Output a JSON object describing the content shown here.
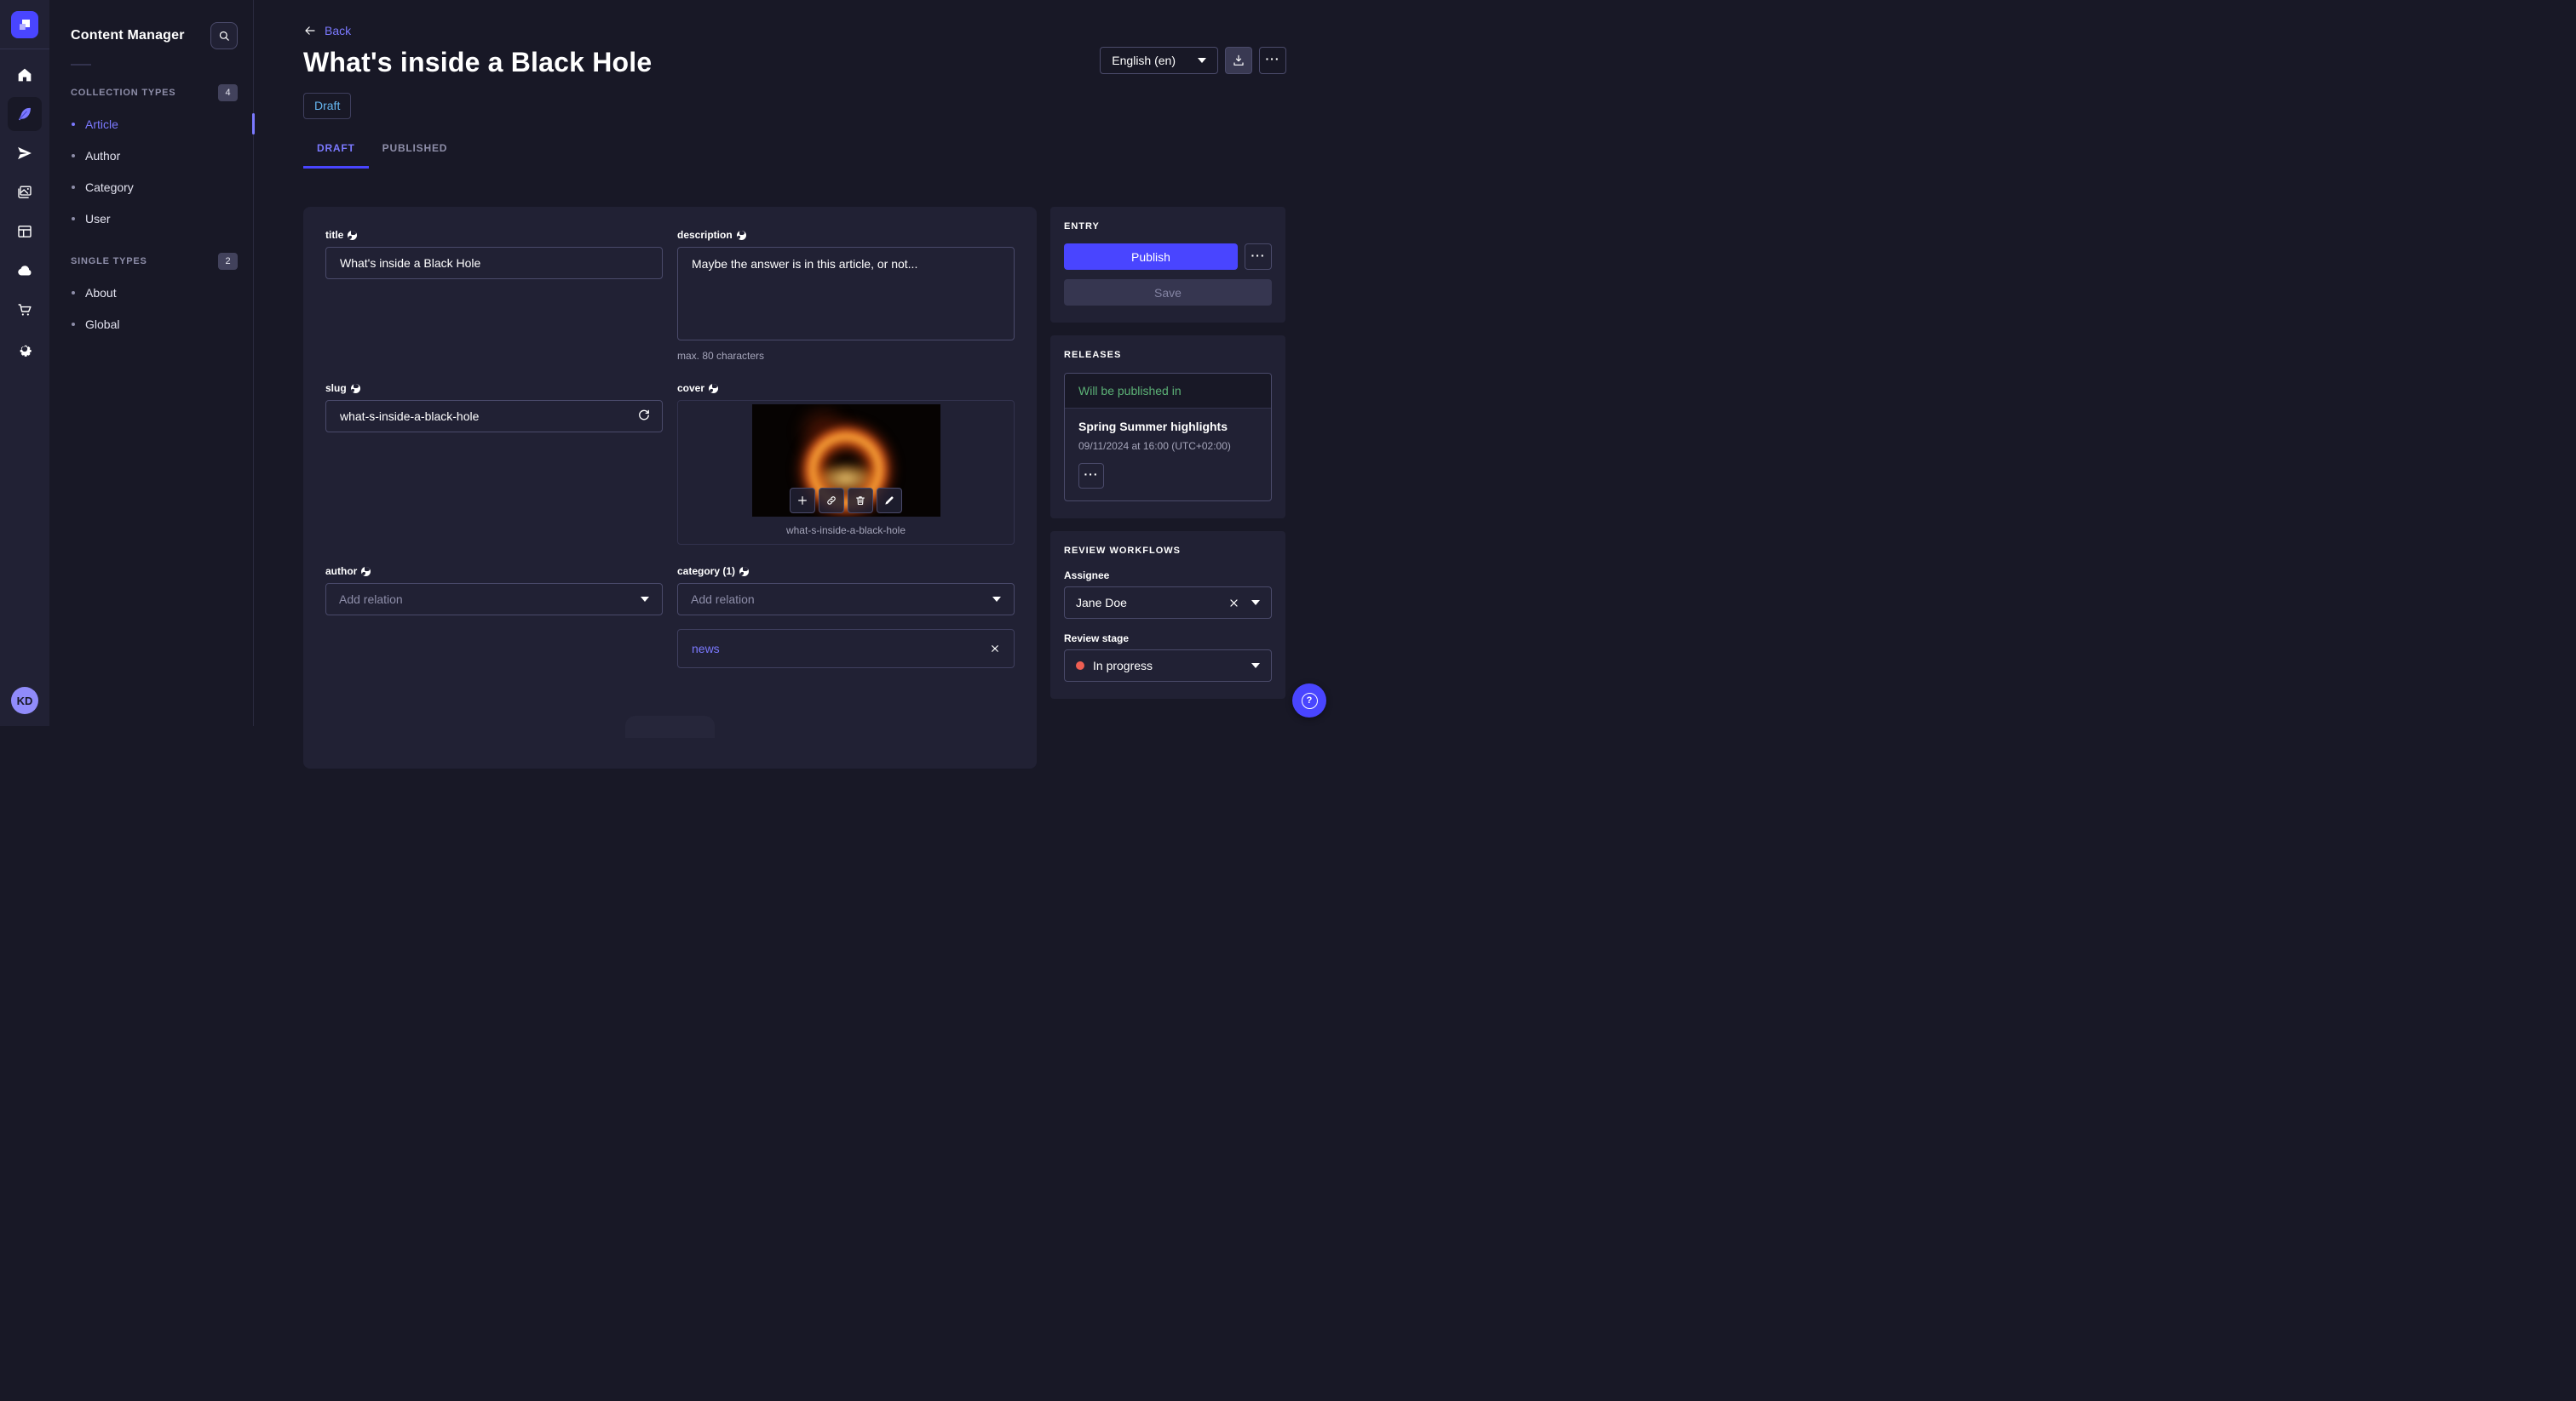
{
  "rail": {
    "avatar_initials": "KD"
  },
  "nav": {
    "title": "Content Manager",
    "sections": [
      {
        "label": "COLLECTION TYPES",
        "count": "4",
        "items": [
          {
            "label": "Article"
          },
          {
            "label": "Author"
          },
          {
            "label": "Category"
          },
          {
            "label": "User"
          }
        ]
      },
      {
        "label": "SINGLE TYPES",
        "count": "2",
        "items": [
          {
            "label": "About"
          },
          {
            "label": "Global"
          }
        ]
      }
    ]
  },
  "header": {
    "back_label": "Back",
    "title": "What's inside a Black Hole",
    "status_badge": "Draft",
    "locale_selected": "English (en)",
    "dots_label": "···"
  },
  "tabs": {
    "draft": "DRAFT",
    "published": "PUBLISHED"
  },
  "form": {
    "title_field": {
      "label": "title",
      "value": "What's inside a Black Hole"
    },
    "description_field": {
      "label": "description",
      "value": "Maybe the answer is in this article, or not...",
      "hint": "max. 80 characters"
    },
    "slug_field": {
      "label": "slug",
      "value": "what-s-inside-a-black-hole"
    },
    "cover_field": {
      "label": "cover",
      "caption": "what-s-inside-a-black-hole"
    },
    "author_field": {
      "label": "author",
      "placeholder": "Add relation"
    },
    "category_field": {
      "label": "category (1)",
      "placeholder": "Add relation",
      "relation": "news"
    }
  },
  "entry_panel": {
    "title": "ENTRY",
    "publish_label": "Publish",
    "save_label": "Save",
    "dots_label": "···"
  },
  "releases_panel": {
    "title": "RELEASES",
    "status": "Will be published in",
    "release_name": "Spring Summer highlights",
    "release_date": "09/11/2024 at 16:00 (UTC+02:00)",
    "dots_label": "···"
  },
  "review_panel": {
    "title": "REVIEW WORKFLOWS",
    "assignee_label": "Assignee",
    "assignee_value": "Jane Doe",
    "stage_label": "Review stage",
    "stage_value": "In progress"
  },
  "help": {
    "label": "?"
  },
  "colors": {
    "primary": "#4945ff",
    "primary_light": "#7b79ff",
    "draft_blue": "#66b7f1",
    "success_green": "#5cb176",
    "danger_red": "#ee5e52"
  }
}
